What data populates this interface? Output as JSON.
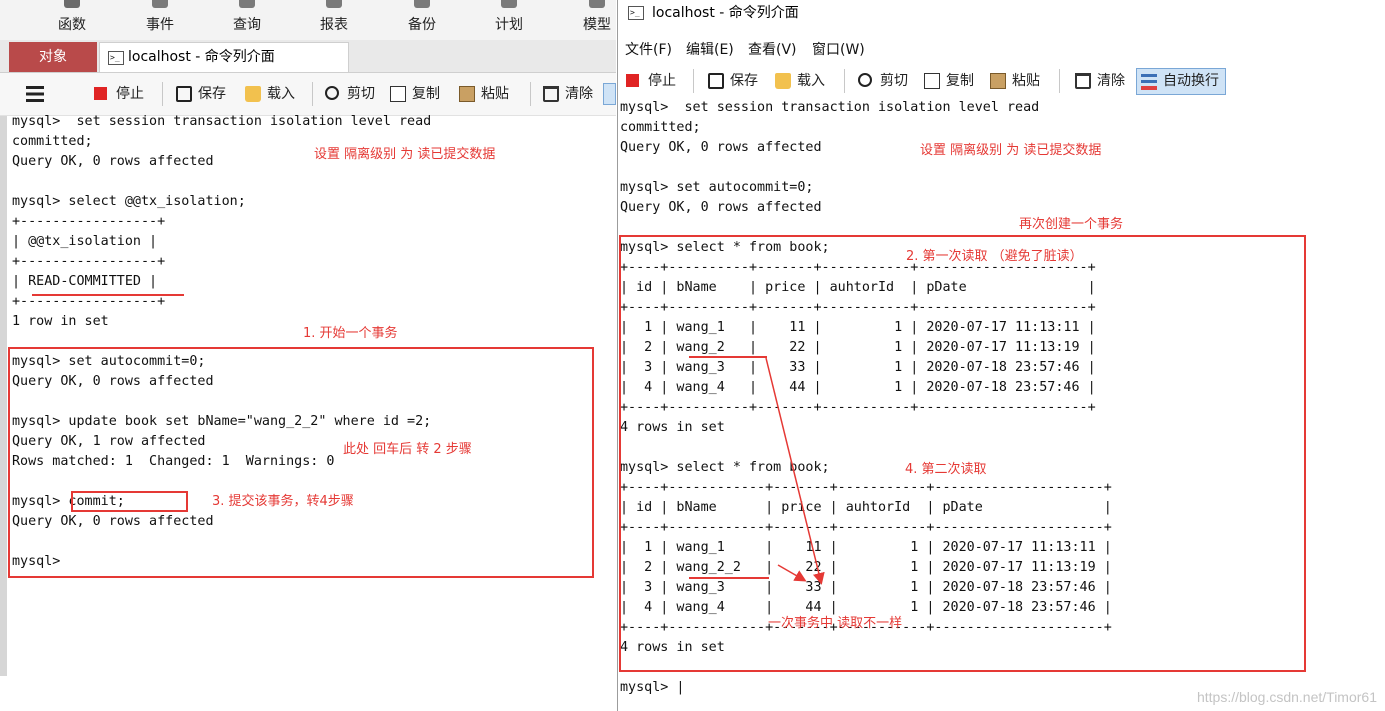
{
  "left": {
    "ribbon": [
      "函数",
      "事件",
      "查询",
      "报表",
      "备份",
      "计划",
      "模型"
    ],
    "tabs": {
      "object": "对象",
      "console": "localhost - 命令列介面"
    },
    "toolbar": {
      "stop": "停止",
      "save": "保存",
      "load": "载入",
      "cut": "剪切",
      "copy": "复制",
      "paste": "粘贴",
      "clear": "清除"
    },
    "console_lines": [
      "mysql>  set session transaction isolation level read",
      "committed;",
      "Query OK, 0 rows affected",
      "",
      "mysql> select @@tx_isolation;",
      "+-----------------+",
      "| @@tx_isolation |",
      "+-----------------+",
      "| READ-COMMITTED |",
      "+-----------------+",
      "1 row in set",
      "",
      "mysql> set autocommit=0;",
      "Query OK, 0 rows affected",
      "",
      "mysql> update book set bName=\"wang_2_2\" where id =2;",
      "Query OK, 1 row affected",
      "Rows matched: 1  Changed: 1  Warnings: 0",
      "",
      "mysql> commit;",
      "Query OK, 0 rows affected",
      "",
      "mysql>"
    ],
    "annotations": {
      "isolation": "设置 隔离级别 为  读已提交数据",
      "step1": "1. 开始一个事务",
      "enter": "此处 回车后 转 2 步骤",
      "step3": "3. 提交该事务，转4步骤"
    }
  },
  "right": {
    "title": "localhost - 命令列介面",
    "menu": [
      "文件(F)",
      "编辑(E)",
      "查看(V)",
      "窗口(W)"
    ],
    "toolbar": {
      "stop": "停止",
      "save": "保存",
      "load": "载入",
      "cut": "剪切",
      "copy": "复制",
      "paste": "粘贴",
      "clear": "清除",
      "wrap": "自动换行"
    },
    "console_lines": [
      "mysql>  set session transaction isolation level read",
      "committed;",
      "Query OK, 0 rows affected",
      "",
      "mysql> set autocommit=0;",
      "Query OK, 0 rows affected",
      "",
      "mysql> select * from book;",
      "+----+----------+-------+-----------+---------------------+",
      "| id | bName    | price | auhtorId  | pDate               |",
      "+----+----------+-------+-----------+---------------------+",
      "|  1 | wang_1   |    11 |         1 | 2020-07-17 11:13:11 |",
      "|  2 | wang_2   |    22 |         1 | 2020-07-17 11:13:19 |",
      "|  3 | wang_3   |    33 |         1 | 2020-07-18 23:57:46 |",
      "|  4 | wang_4   |    44 |         1 | 2020-07-18 23:57:46 |",
      "+----+----------+-------+-----------+---------------------+",
      "4 rows in set",
      "",
      "mysql> select * from book;",
      "+----+------------+-------+-----------+---------------------+",
      "| id | bName      | price | auhtorId  | pDate               |",
      "+----+------------+-------+-----------+---------------------+",
      "|  1 | wang_1     |    11 |         1 | 2020-07-17 11:13:11 |",
      "|  2 | wang_2_2   |    22 |         1 | 2020-07-17 11:13:19 |",
      "|  3 | wang_3     |    33 |         1 | 2020-07-18 23:57:46 |",
      "|  4 | wang_4     |    44 |         1 | 2020-07-18 23:57:46 |",
      "+----+------------+-------+-----------+---------------------+",
      "4 rows in set",
      "",
      "mysql> |"
    ],
    "annotations": {
      "isolation": "设置 隔离级别 为  读已提交数据",
      "again": "再次创建一个事务",
      "step2": "2. 第一次读取  （避免了脏读）",
      "step4": "4. 第二次读取",
      "differ": "一次事务中  读取不一样"
    }
  },
  "watermark": "https://blog.csdn.net/Timor61",
  "colors": {
    "annotation": "#e53935",
    "object_tab": "#b94a4a"
  }
}
